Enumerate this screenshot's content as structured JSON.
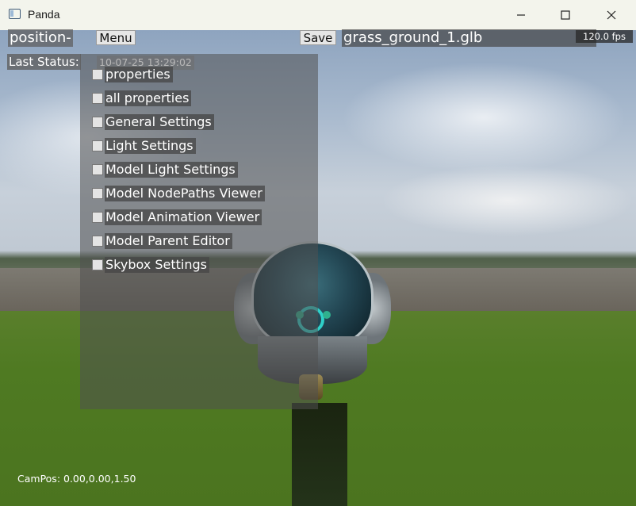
{
  "window": {
    "title": "Panda",
    "controls": {
      "minimize": "minimize-icon",
      "maximize": "maximize-icon",
      "close": "close-icon"
    }
  },
  "hud": {
    "position_label": "position-",
    "menu_button": "Menu",
    "save_button": "Save",
    "file_value": "grass_ground_1.glb",
    "fps": "120.0 fps",
    "last_status_label": "Last Status:",
    "last_status_time": "10-07-25 13:29:02",
    "campos": "CamPos: 0.00,0.00,1.50"
  },
  "menu": {
    "items": [
      {
        "label": "properties",
        "checked": false
      },
      {
        "label": "all properties",
        "checked": false
      },
      {
        "label": "General Settings",
        "checked": false
      },
      {
        "label": "Light Settings",
        "checked": false
      },
      {
        "label": "Model Light Settings",
        "checked": false
      },
      {
        "label": "Model NodePaths Viewer",
        "checked": false
      },
      {
        "label": "Model Animation Viewer",
        "checked": false
      },
      {
        "label": "Model Parent Editor",
        "checked": false
      },
      {
        "label": "Skybox Settings",
        "checked": false
      }
    ]
  },
  "colors": {
    "titlebar": "#f3f4ec",
    "grass": "#4f7a22",
    "panel": "#505050",
    "accent_cyan": "#2fd0c9"
  }
}
